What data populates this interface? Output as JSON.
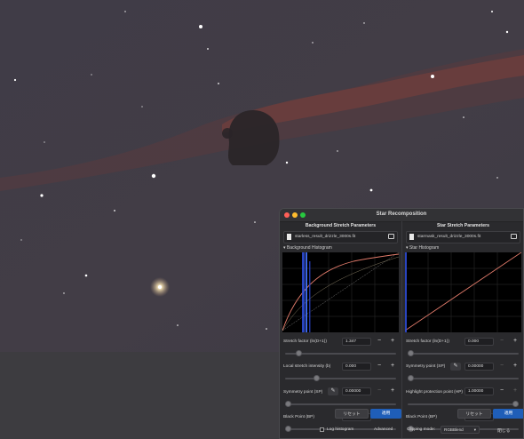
{
  "dialog": {
    "title": "Star Recomposition",
    "clipping_label": "Clipping mode:",
    "clipping_value": "RGBBlend",
    "log_histogram_label": "Log histogram",
    "advanced_label": "Advanced",
    "close_label": "閉じる"
  },
  "left": {
    "header": "Background Stretch Parameters",
    "file": "starless_result_drizzle_3000s.fit",
    "hist_label": "Background Histogram",
    "stretch_label": "Stretch factor (ln(D+1))",
    "stretch_value": "1.347",
    "local_label": "Local stretch intensity (b)",
    "local_value": "0.000",
    "sp_label": "Symmetry point (SP)",
    "sp_value": "0.00000",
    "bp_label": "Black Point (BP)",
    "bp_value": "0.00000",
    "reset": "リセット",
    "apply": "適用",
    "sliders": {
      "stretch": 0.1,
      "local": 0.27,
      "sp": 0.0,
      "bp": 0.0
    }
  },
  "right": {
    "header": "Star Stretch Parameters",
    "file": "starmask_result_drizzle_3000s.fit",
    "hist_label": "Star Histogram",
    "stretch_label": "Stretch factor (ln(D+1))",
    "stretch_value": "0.000",
    "sp_label": "Symmetry point (SP)",
    "sp_value": "0.00000",
    "hp_label": "Highlight protection point (HP)",
    "hp_value": "1.00000",
    "bp_label": "Black Point (BP)",
    "bp_value": "0.00000",
    "reset": "リセット",
    "apply": "適用",
    "sliders": {
      "stretch": 0.0,
      "sp": 0.0,
      "hp": 1.0,
      "bp": 0.0
    }
  }
}
